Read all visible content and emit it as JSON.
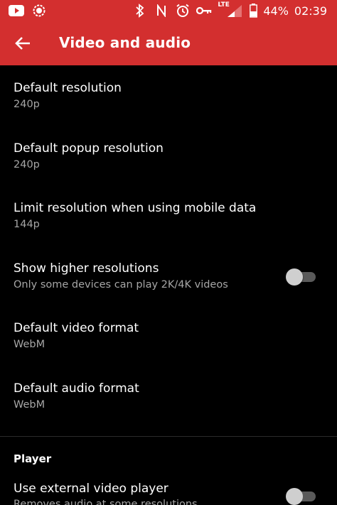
{
  "status_bar": {
    "icons_left": [
      "youtube-icon",
      "signal-app-icon"
    ],
    "icons_right": [
      "bluetooth-icon",
      "nfc-icon",
      "alarm-icon",
      "key-icon",
      "lte-signal-icon",
      "battery-icon"
    ],
    "lte_label": "LTE",
    "battery": "44%",
    "time": "02:39"
  },
  "app_bar": {
    "title": "Video and audio",
    "back_icon": "arrow-back-icon",
    "color": "#d32f2f"
  },
  "settings": [
    {
      "title": "Default resolution",
      "value": "240p"
    },
    {
      "title": "Default popup resolution",
      "value": "240p"
    },
    {
      "title": "Limit resolution when using mobile data",
      "value": "144p"
    },
    {
      "title": "Show higher resolutions",
      "value": "Only some devices can play 2K/4K videos",
      "toggle": false
    },
    {
      "title": "Default video format",
      "value": "WebM"
    },
    {
      "title": "Default audio format",
      "value": "WebM"
    }
  ],
  "player_section": {
    "header": "Player",
    "items": [
      {
        "title": "Use external video player",
        "value": "Removes audio at some resolutions",
        "toggle": false
      }
    ]
  }
}
